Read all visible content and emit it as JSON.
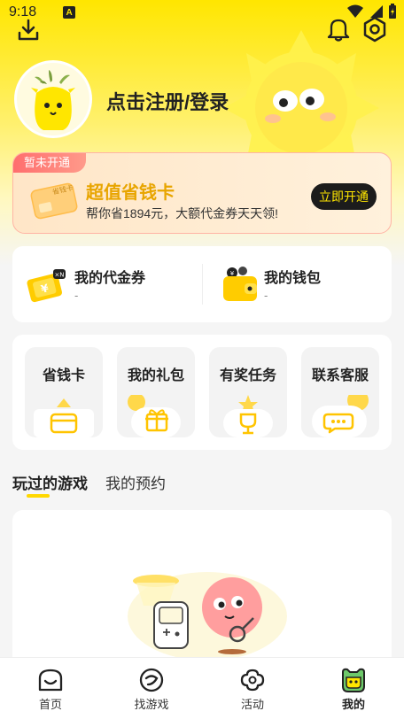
{
  "status_bar": {
    "time": "9:18",
    "notification_letter": "A"
  },
  "profile": {
    "login_label": "点击注册/登录"
  },
  "vip_card": {
    "tag": "暂未开通",
    "title": "超值省钱卡",
    "subtitle": "帮你省1894元，大额代金券天天领!",
    "button": "立即开通",
    "card_thumb_text": "省钱卡"
  },
  "wallet": {
    "items": [
      {
        "label": "我的代金券",
        "value": "-",
        "icon": "voucher-icon"
      },
      {
        "label": "我的钱包",
        "value": "-",
        "icon": "wallet-icon"
      }
    ]
  },
  "shortcuts": {
    "items": [
      {
        "label": "省钱卡",
        "icon": "card-icon"
      },
      {
        "label": "我的礼包",
        "icon": "gift-icon"
      },
      {
        "label": "有奖任务",
        "icon": "trophy-icon"
      },
      {
        "label": "联系客服",
        "icon": "chat-icon"
      }
    ]
  },
  "tabs": [
    {
      "label": "玩过的游戏",
      "active": true
    },
    {
      "label": "我的预约",
      "active": false
    }
  ],
  "bottom_nav": {
    "items": [
      {
        "label": "首页",
        "icon": "home-icon",
        "active": false
      },
      {
        "label": "找游戏",
        "icon": "discover-icon",
        "active": false
      },
      {
        "label": "活动",
        "icon": "activity-icon",
        "active": false
      },
      {
        "label": "我的",
        "icon": "profile-icon",
        "active": true
      }
    ]
  },
  "colors": {
    "brand_yellow": "#ffe600",
    "accent_gold": "#e8a500",
    "dark": "#1c1c1c"
  }
}
